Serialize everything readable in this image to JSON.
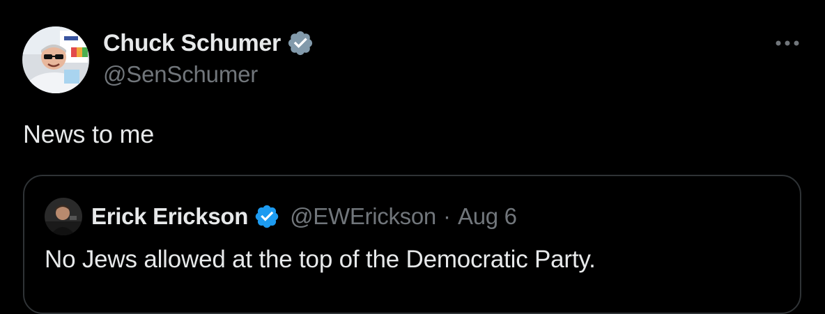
{
  "tweet": {
    "author": {
      "name": "Chuck Schumer",
      "handle": "@SenSchumer",
      "badge": "gray-verified-icon",
      "avatar_icon": "avatar-photo"
    },
    "text": "News to me",
    "more_icon": "more-horizontal-icon"
  },
  "quote": {
    "author": {
      "name": "Erick Erickson",
      "handle": "@EWErickson",
      "badge": "blue-verified-icon",
      "avatar_icon": "avatar-photo"
    },
    "separator": "·",
    "date": "Aug 6",
    "text": "No Jews allowed at the top of the Democratic Party."
  },
  "colors": {
    "background": "#000000",
    "text_primary": "#e7e9ea",
    "text_secondary": "#71767b",
    "border": "#2f3336",
    "gov_badge": "#829aab",
    "blue_badge": "#1d9bf0"
  }
}
